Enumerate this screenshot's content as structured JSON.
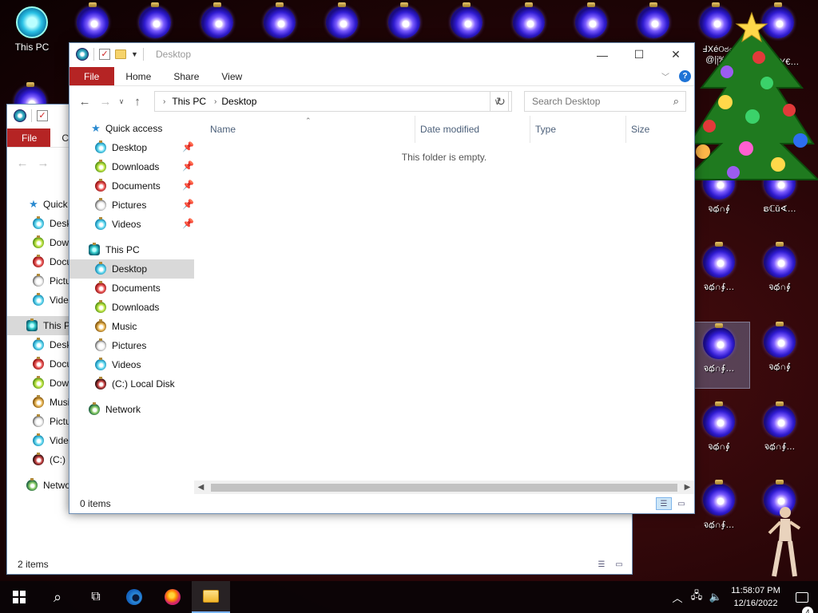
{
  "desktop": {
    "this_pc_label": "This PC",
    "garbled_labels": [
      "߃Xéଠಠஎ",
      "@|༏‰ச",
      "ๅ|Y€…",
      "จథ∩∮",
      "ຣℂǔ∢…",
      "จథ∩∮…",
      "จథ∩∮",
      "จథ∩∮…",
      "จథ∩∮",
      "จథ∩∮",
      "จథ∩∮…",
      "จథ∩∮…"
    ],
    "accent_ornament": "#2f1bd0"
  },
  "back_window": {
    "tabs": {
      "file": "File",
      "computer_partial": "C"
    },
    "nav": {
      "quick_access": "Quick",
      "items": [
        "Desk",
        "Dow",
        "Docu",
        "Pictu",
        "Vide"
      ],
      "this_pc": "This P",
      "pc_items": [
        "Desk",
        "Docu",
        "Dow",
        "Musi",
        "Pictu",
        "Vide",
        "(C:) L"
      ],
      "network": "Netwo"
    },
    "status": {
      "count": "2 items"
    }
  },
  "front_window": {
    "title": "Desktop",
    "ribbon": {
      "file": "File",
      "home": "Home",
      "share": "Share",
      "view": "View"
    },
    "address": {
      "crumb1": "This PC",
      "crumb2": "Desktop"
    },
    "search": {
      "placeholder": "Search Desktop"
    },
    "nav": {
      "quick_access": "Quick access",
      "quick_items": [
        "Desktop",
        "Downloads",
        "Documents",
        "Pictures",
        "Videos"
      ],
      "this_pc": "This PC",
      "pc_items": [
        "Desktop",
        "Documents",
        "Downloads",
        "Music",
        "Pictures",
        "Videos",
        "(C:) Local Disk"
      ],
      "network": "Network"
    },
    "columns": {
      "name": "Name",
      "date": "Date modified",
      "type": "Type",
      "size": "Size"
    },
    "empty_message": "This folder is empty.",
    "status": {
      "count": "0 items"
    },
    "colors": {
      "file_tab": "#b52424",
      "selection": "#d9d9d9",
      "help": "#1e73d6"
    }
  },
  "taskbar": {
    "time": "11:58:07 PM",
    "date": "12/16/2022",
    "notifications": "4"
  }
}
